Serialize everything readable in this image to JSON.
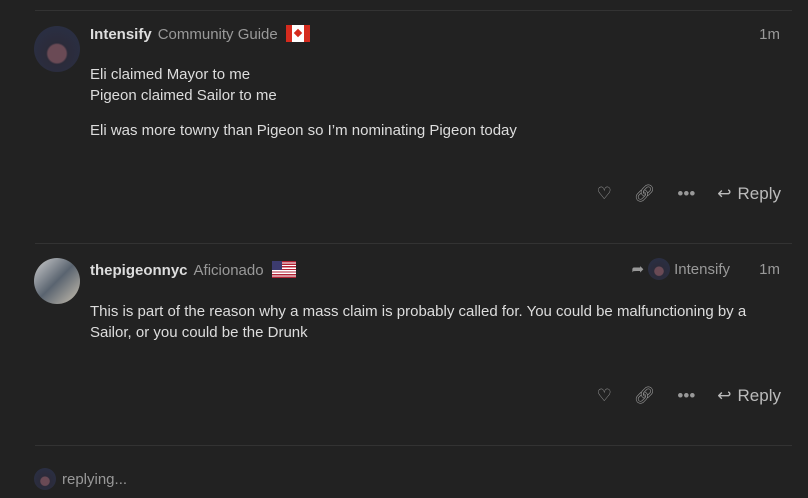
{
  "posts": [
    {
      "username": "Intensify",
      "user_title": "Community Guide",
      "flag": "canada-flag",
      "time": "1m",
      "paragraphs": [
        "Eli claimed Mayor to me\nPigeon claimed Sailor to me",
        "Eli was more towny than Pigeon so I’m nominating Pigeon today"
      ],
      "reply_label": "Reply"
    },
    {
      "username": "thepigeonnyc",
      "user_title": "Aficionado",
      "flag": "usa-flag",
      "time": "1m",
      "reply_to": "Intensify",
      "paragraphs": [
        "This is part of the reason why a mass claim is probably called for. You could be malfunctioning by a Sailor, or you could be the Drunk"
      ],
      "reply_label": "Reply"
    }
  ],
  "footer": {
    "status": "replying..."
  }
}
